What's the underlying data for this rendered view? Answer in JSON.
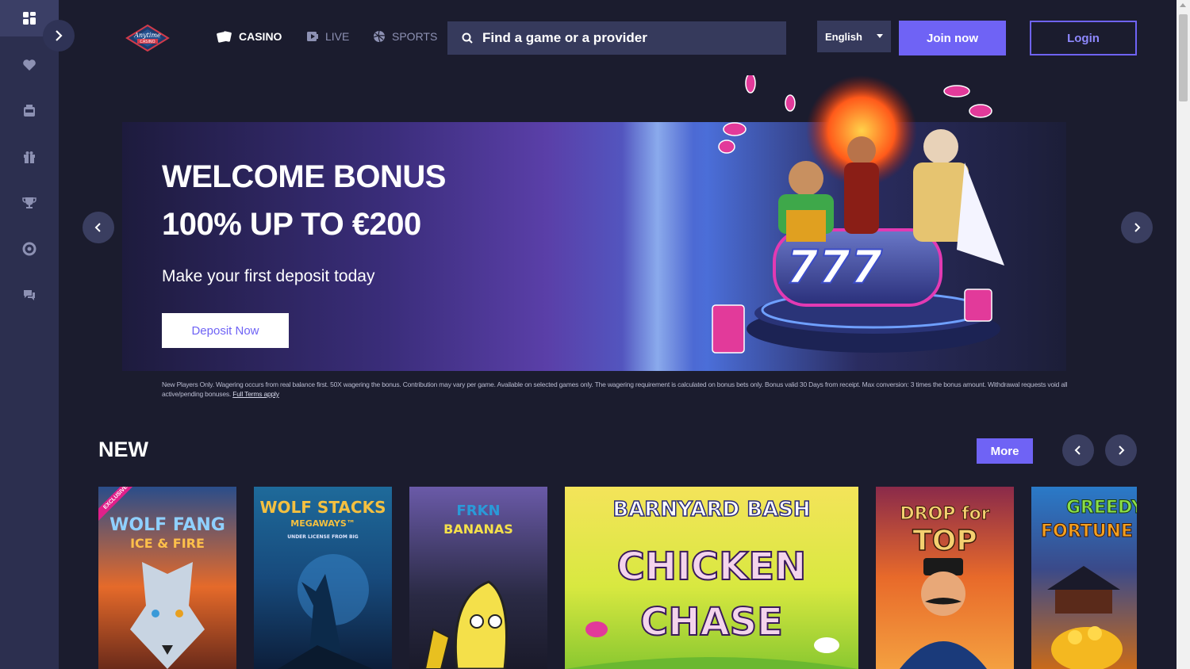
{
  "sidebar": {
    "items": [
      {
        "icon": "dashboard-icon"
      },
      {
        "icon": "heart-icon"
      },
      {
        "icon": "slots-icon"
      },
      {
        "icon": "gift-icon"
      },
      {
        "icon": "trophy-icon"
      },
      {
        "icon": "lifebuoy-icon"
      },
      {
        "icon": "chat-icon"
      }
    ]
  },
  "header": {
    "nav": [
      {
        "label": "CASINO",
        "icon": "cards-icon"
      },
      {
        "label": "LIVE",
        "icon": "live-icon"
      },
      {
        "label": "SPORTS",
        "icon": "ball-icon"
      }
    ],
    "search_placeholder": "Find a game or a provider",
    "language": "English",
    "join_label": "Join now",
    "login_label": "Login"
  },
  "banner": {
    "title_line1": "WELCOME BONUS",
    "title_line2": "100% UP TO €200",
    "subtitle": "Make your first deposit today",
    "button_label": "Deposit Now",
    "terms": "New Players Only. Wagering occurs from real balance first. 50X wagering the bonus. Contribution may vary per game. Available on selected games only. The wagering requirement is calculated on bonus bets only. Bonus valid 30 Days from receipt. Max conversion: 3 times the bonus amount. Withdrawal requests void all active/pending bonuses.",
    "terms_link": "Full Terms apply"
  },
  "new_section": {
    "title": "NEW",
    "more_label": "More",
    "games": [
      {
        "title": "WOLF FANG",
        "subtitle": "ICE & FIRE",
        "badge": "EXCLUSIVE"
      },
      {
        "title": "WOLF STACKS",
        "subtitle": "MEGAWAYS™",
        "note": "UNDER LICENSE FROM BIG"
      },
      {
        "title": "FRKN",
        "subtitle": "BANANAS"
      },
      {
        "title": "BARNYARD BASH",
        "subtitle": "CHICKEN CHASE"
      },
      {
        "title": "DROP for",
        "subtitle": "TOP"
      },
      {
        "title": "GREEDY",
        "subtitle": "FORTUNE P"
      }
    ]
  },
  "colors": {
    "accent": "#6f63f5",
    "sidebar": "#2c2f4f",
    "background": "#1b1c2e"
  }
}
